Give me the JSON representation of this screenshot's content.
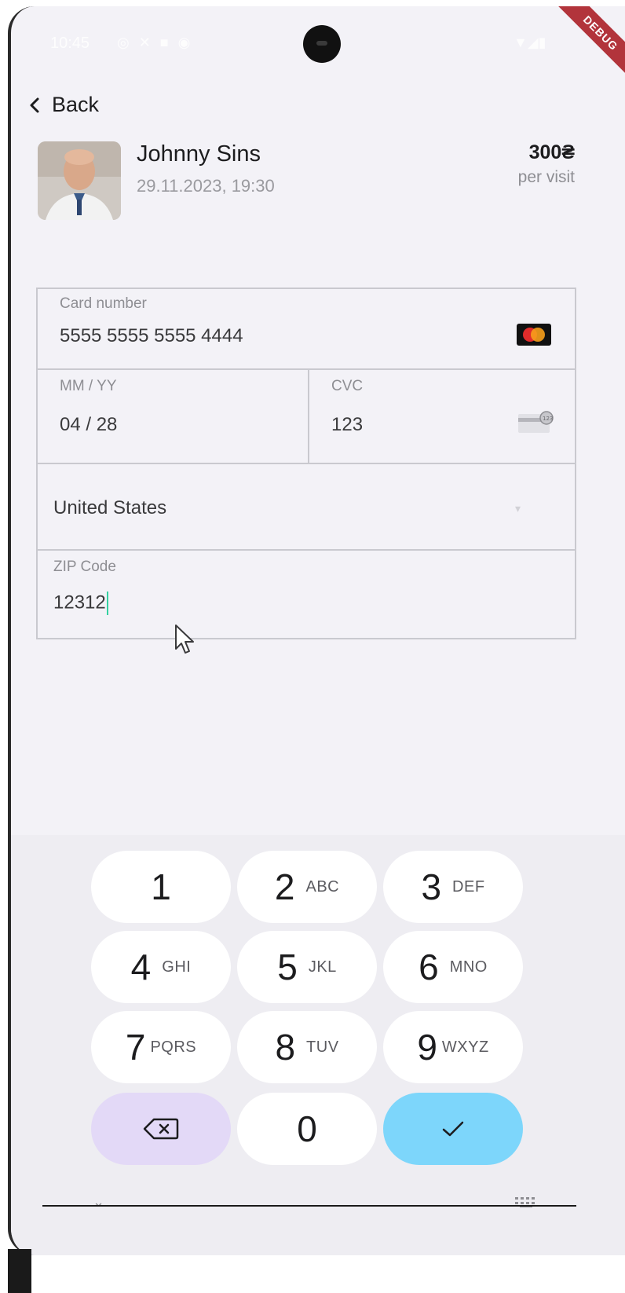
{
  "status_bar": {
    "time": "10:45",
    "debug_banner": "DEBUG"
  },
  "nav": {
    "back_label": "Back"
  },
  "appointment": {
    "doctor_name": "Johnny Sins",
    "datetime": "29.11.2023, 19:30",
    "price": "300₴",
    "price_unit": "per visit"
  },
  "payment_form": {
    "card_number": {
      "label": "Card number",
      "value": "5555 5555 5555 4444",
      "brand_icon": "mastercard-icon"
    },
    "expiry": {
      "label": "MM / YY",
      "value": "04 / 28"
    },
    "cvc": {
      "label": "CVC",
      "value": "123",
      "icon": "card-cvc-icon"
    },
    "country": {
      "value": "United States"
    },
    "zip": {
      "label": "ZIP Code",
      "value": "12312"
    }
  },
  "keypad": {
    "keys": [
      {
        "digit": "1",
        "letters": ""
      },
      {
        "digit": "2",
        "letters": "ABC"
      },
      {
        "digit": "3",
        "letters": "DEF"
      },
      {
        "digit": "4",
        "letters": "GHI"
      },
      {
        "digit": "5",
        "letters": "JKL"
      },
      {
        "digit": "6",
        "letters": "MNO"
      },
      {
        "digit": "7",
        "letters": "PQRS"
      },
      {
        "digit": "8",
        "letters": "TUV"
      },
      {
        "digit": "9",
        "letters": "WXYZ"
      },
      {
        "digit": "0",
        "letters": ""
      }
    ],
    "backspace_icon": "backspace-icon",
    "done_icon": "checkmark-icon"
  },
  "colors": {
    "background": "#f3f2f7",
    "backspace_key": "#e3d9f7",
    "done_key": "#7dd6fb",
    "caret": "#34d1a1",
    "debug_ribbon": "#b2343b"
  }
}
